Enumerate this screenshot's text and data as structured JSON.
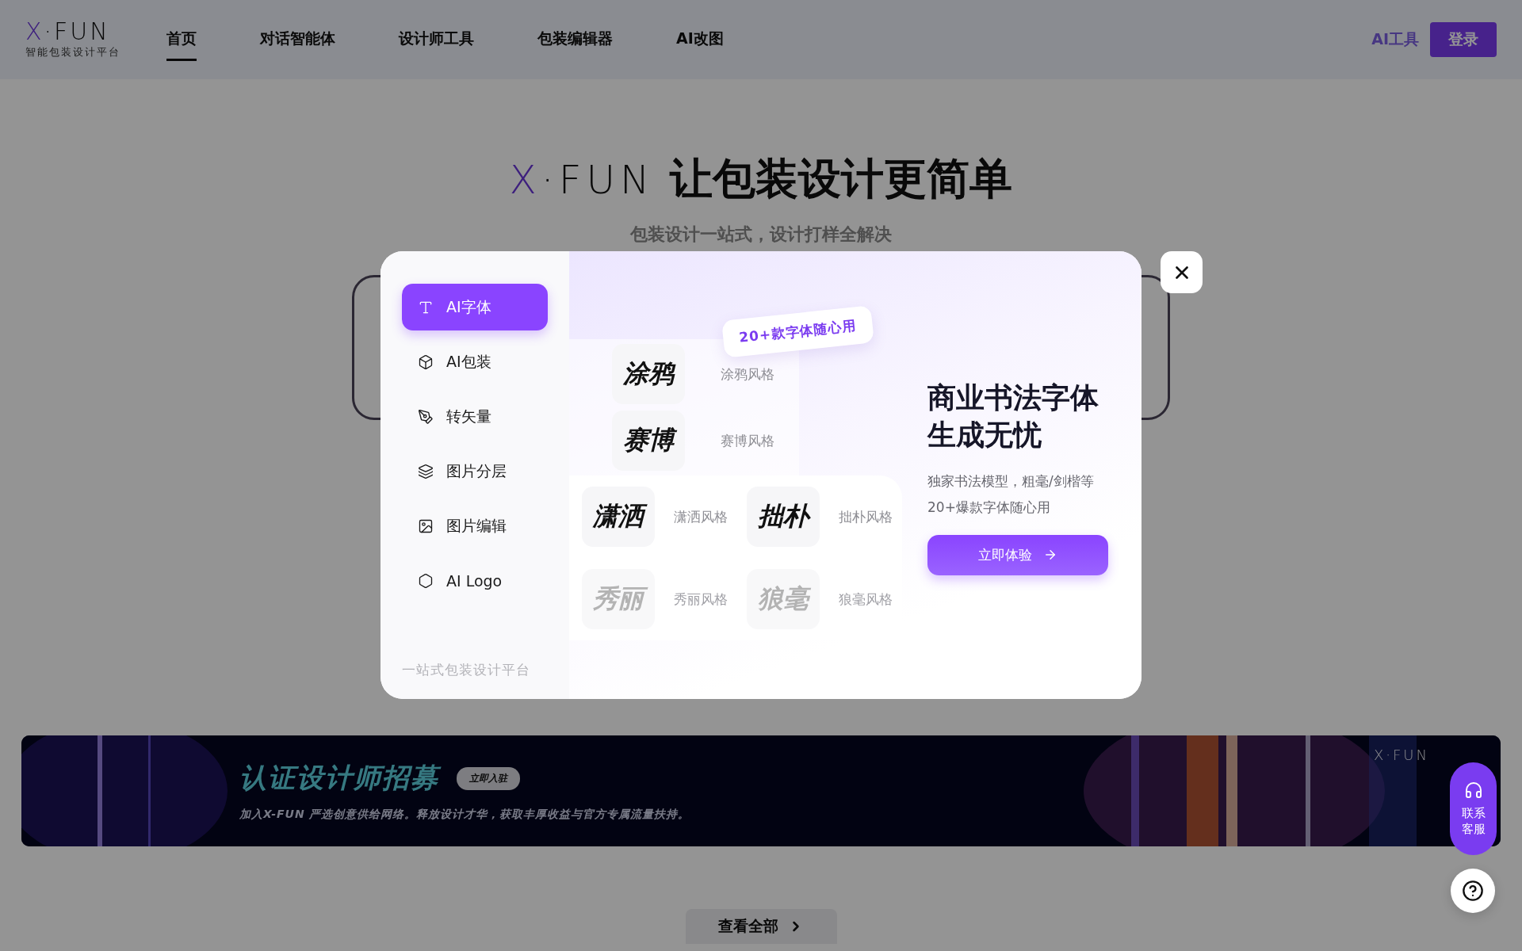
{
  "header": {
    "logo": {
      "brand": "X·FUN",
      "tagline": "智能包装设计平台"
    },
    "nav": [
      {
        "label": "首页",
        "selected": true
      },
      {
        "label": "对话智能体",
        "selected": false
      },
      {
        "label": "设计师工具",
        "selected": false
      },
      {
        "label": "包装编辑器",
        "selected": false
      },
      {
        "label": "AI改图",
        "selected": false
      }
    ],
    "ai_tools_link": "AI工具",
    "login_button": "登录"
  },
  "hero": {
    "brand": "X·FUN",
    "title": "让包装设计更简单",
    "subtitle": "包装设计一站式，设计打样全解决"
  },
  "modal": {
    "menu": [
      {
        "label": "AI字体",
        "selected": true
      },
      {
        "label": "AI包装",
        "selected": false
      },
      {
        "label": "转矢量",
        "selected": false
      },
      {
        "label": "图片分层",
        "selected": false
      },
      {
        "label": "图片编辑",
        "selected": false
      },
      {
        "label": "AI Logo",
        "selected": false
      }
    ],
    "footer": "一站式包装设计平台",
    "bubble": "20+款字体随心用",
    "font_samples": [
      {
        "sample": "涂鸦",
        "label": "涂鸦风格",
        "faded": false
      },
      {
        "sample": "赛博",
        "label": "赛博风格",
        "faded": false
      },
      {
        "sample": "潇洒",
        "label": "潇洒风格",
        "faded": false
      },
      {
        "sample": "拙朴",
        "label": "拙朴风格",
        "faded": false
      },
      {
        "sample": "秀丽",
        "label": "秀丽风格",
        "faded": true
      },
      {
        "sample": "狼毫",
        "label": "狼毫风格",
        "faded": true
      }
    ],
    "heading": "商业书法字体生成无忧",
    "description": "独家书法模型，粗毫/剑楷等20+爆款字体随心用",
    "cta": "立即体验"
  },
  "banner": {
    "title": "认证设计师招募",
    "badge": "立即入驻",
    "text": "加入X-FUN 严选创意供给网络。释放设计才华，获取丰厚收益与官方专属流量扶持。",
    "logo": "X·FUN"
  },
  "contact_button": "联系客服",
  "view_all_button": "查看全部"
}
